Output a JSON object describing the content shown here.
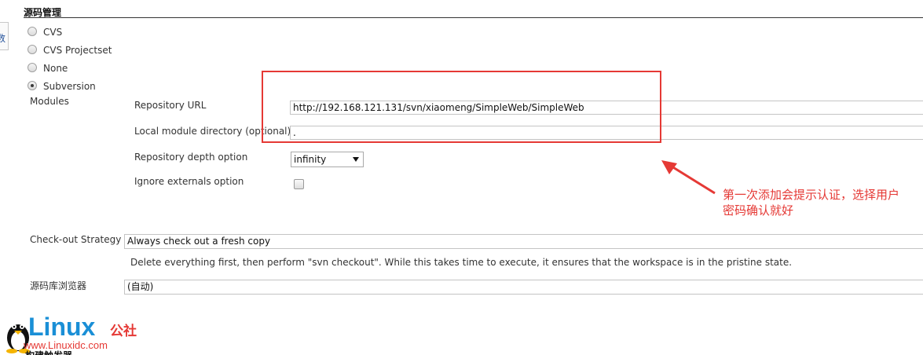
{
  "section": {
    "title": "源码管理"
  },
  "left_edge": {
    "text": "数"
  },
  "scm_options": [
    {
      "label": "CVS",
      "selected": false
    },
    {
      "label": "CVS Projectset",
      "selected": false
    },
    {
      "label": "None",
      "selected": false
    },
    {
      "label": "Subversion",
      "selected": true
    }
  ],
  "modules": {
    "label": "Modules",
    "repository_url": {
      "label": "Repository URL",
      "value": "http://192.168.121.131/svn/xiaomeng/SimpleWeb/SimpleWeb"
    },
    "local_module_directory": {
      "label": "Local module directory (optional)",
      "value": "."
    },
    "repository_depth": {
      "label": "Repository depth option",
      "value": "infinity"
    },
    "ignore_externals": {
      "label": "Ignore externals option",
      "checked": false
    }
  },
  "checkout_strategy": {
    "label": "Check-out Strategy",
    "value": "Always check out a fresh copy",
    "description": "Delete everything first, then perform \"svn checkout\". While this takes time to execute, it ensures that the workspace is in the pristine state."
  },
  "repo_browser": {
    "label": "源码库浏览器",
    "value": "(自动)"
  },
  "annotation": {
    "line1": "第一次添加会提示认证，选择用户",
    "line2": "密码确认就好",
    "color": "#e53935"
  },
  "watermark": {
    "brand": "Linux",
    "brand_suffix": "公社",
    "url": "www.Linuxidc.com",
    "partial_text": "构建触发器"
  }
}
